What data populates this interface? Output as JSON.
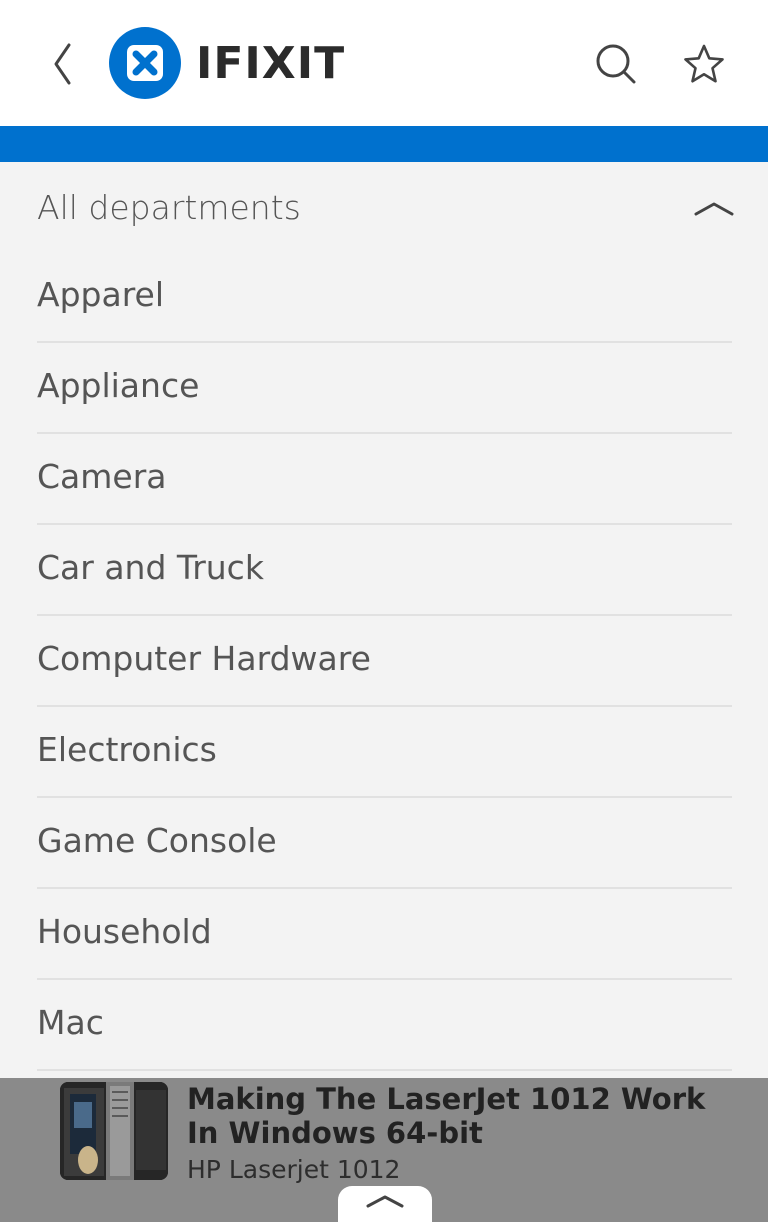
{
  "header": {
    "logo_text": "IFIXIT",
    "back_icon": "chevron-left-icon",
    "search_icon": "search-icon",
    "favorite_icon": "star-icon"
  },
  "colors": {
    "brand_blue": "#0071ce",
    "dropdown_bg": "#f3f3f3",
    "overlay_bg": "#8a8a8a"
  },
  "departments": {
    "header_label": "All departments",
    "items": [
      {
        "label": "Apparel"
      },
      {
        "label": "Appliance"
      },
      {
        "label": "Camera"
      },
      {
        "label": "Car and Truck"
      },
      {
        "label": "Computer Hardware"
      },
      {
        "label": "Electronics"
      },
      {
        "label": "Game Console"
      },
      {
        "label": "Household"
      },
      {
        "label": "Mac"
      }
    ]
  },
  "guide_card": {
    "title": "Making The LaserJet 1012 Work In Windows 64-bit",
    "subtitle": "HP Laserjet 1012"
  }
}
